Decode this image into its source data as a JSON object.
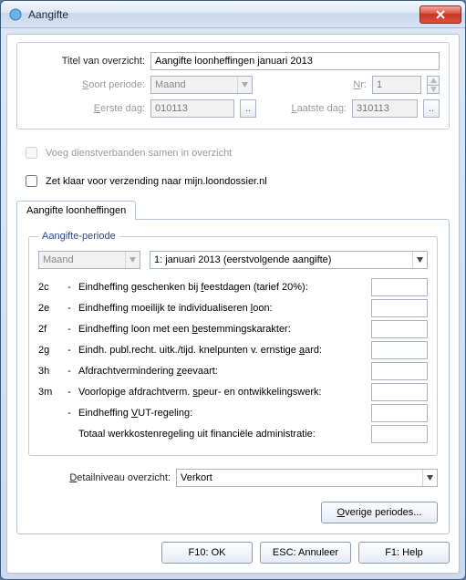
{
  "window": {
    "title": "Aangifte"
  },
  "top": {
    "title_label": "Titel van overzicht:",
    "title_value": "Aangifte loonheffingen januari 2013",
    "soort_label_pre": "S",
    "soort_label_post": "oort periode:",
    "soort_value": "Maand",
    "nr_label_pre": "N",
    "nr_label_post": "r:",
    "nr_value": "1",
    "eerste_label_pre": "E",
    "eerste_label_post": "erste dag:",
    "eerste_value": "010113",
    "laatste_label_pre": "L",
    "laatste_label_post": "aatste dag:",
    "laatste_value": "310113"
  },
  "checks": {
    "samen": "Voeg dienstverbanden samen in overzicht",
    "loondossier": "Zet klaar voor verzending naar mijn.loondossier.nl"
  },
  "tabs": {
    "main": "Aangifte loonheffingen"
  },
  "period": {
    "legend": "Aangifte-periode",
    "freq_value": "Maand",
    "selection": "1: januari 2013 (eerstvolgende aangifte)"
  },
  "lines": [
    {
      "code": "2c",
      "desc_pre": "Eindheffing geschenken bij ",
      "u": "f",
      "desc_post": "eestdagen (tarief 20%):"
    },
    {
      "code": "2e",
      "desc_pre": "Eindheffing moeilijk te individualiseren ",
      "u": "l",
      "desc_post": "oon:"
    },
    {
      "code": "2f",
      "desc_pre": "Eindheffing loon met een ",
      "u": "b",
      "desc_post": "estemmingskarakter:"
    },
    {
      "code": "2g",
      "desc_pre": "Eindh. publ.recht. uitk./tijd. knelpunten v. ernstige ",
      "u": "a",
      "desc_post": "ard:"
    },
    {
      "code": "3h",
      "desc_pre": "Afdrachtvermindering ",
      "u": "z",
      "desc_post": "eevaart:"
    },
    {
      "code": "3m",
      "desc_pre": "Voorlopige afdrachtverm. ",
      "u": "s",
      "desc_post": "peur- en ontwikkelingswerk:"
    },
    {
      "code": "",
      "desc_pre": "Eindheffing ",
      "u": "V",
      "desc_post": "UT-regeling:"
    },
    {
      "code": "",
      "desc_pre": "Totaal werkkostenregeling uit financiële administratie:",
      "u": "",
      "desc_post": ""
    }
  ],
  "detail": {
    "label_pre": "D",
    "label_post": "etailniveau overzicht:",
    "value": "Verkort"
  },
  "buttons": {
    "overige": "Overige periodes...",
    "overige_u": "O",
    "ok": "F10: OK",
    "cancel": "ESC: Annuleer",
    "help": "F1: Help"
  }
}
